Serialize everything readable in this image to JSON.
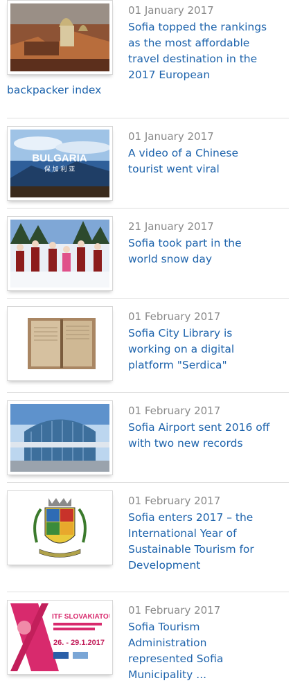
{
  "news": [
    {
      "date": "01 January 2017",
      "title_lines": "Sofia topped the rankings\nas the most affordable\ntravel destination in the\n2017 European",
      "title_tail": "backpacker index",
      "image": "sofia-church-panorama"
    },
    {
      "date": "01 January 2017",
      "title_lines": "A video of a Chinese\ntourist went viral",
      "image": "bulgaria-video-still",
      "image_text": "BULGARIA",
      "image_subtext": "保 加 利 亚"
    },
    {
      "date": "21 January 2017",
      "title_lines": "Sofia took part in the\nworld snow day",
      "image": "snow-day-group-photo"
    },
    {
      "date": "01 February 2017",
      "title_lines": "Sofia City Library is\nworking on a digital\nplatform \"Serdica\"",
      "image": "old-book-pages"
    },
    {
      "date": "01 February 2017",
      "title_lines": "Sofia Airport sent 2016 off\nwith two new records",
      "image": "sofia-airport-terminal"
    },
    {
      "date": "01 February 2017",
      "title_lines": "Sofia enters 2017 – the\nInternational Year of\nSustainable Tourism for\nDevelopment",
      "image": "sofia-coat-of-arms"
    },
    {
      "date": "01 February 2017",
      "title_lines": "Sofia Tourism\nAdministration\nrepresented Sofia\nMunicipality ...",
      "image": "itf-slovakiatour-poster",
      "image_text": "ITF SLOVAKIATOUR",
      "image_subtext": "26. - 29.1.2017"
    }
  ],
  "colors": {
    "link": "#1d63ac",
    "date": "#8a8a8a",
    "divider": "#dedede"
  }
}
